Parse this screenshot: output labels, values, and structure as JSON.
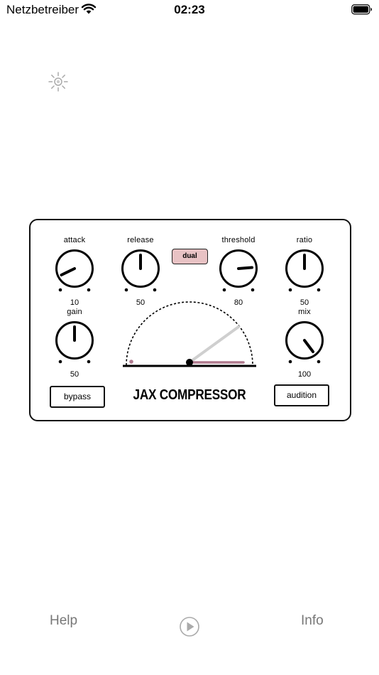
{
  "status_bar": {
    "carrier": "Netzbetreiber",
    "time": "02:23",
    "icons": [
      "wifi-icon",
      "battery-icon"
    ]
  },
  "toolbar": {
    "icon": "brightness-icon"
  },
  "plugin": {
    "title": "JAX COMPRESSOR",
    "knobs": {
      "attack": {
        "label": "attack",
        "value": "10"
      },
      "release": {
        "label": "release",
        "value": "50"
      },
      "threshold": {
        "label": "threshold",
        "value": "80"
      },
      "ratio": {
        "label": "ratio",
        "value": "50"
      },
      "gain": {
        "label": "gain",
        "value": "50"
      },
      "mix": {
        "label": "mix",
        "value": "100"
      }
    },
    "dual_label": "dual",
    "bypass_label": "bypass",
    "audition_label": "audition",
    "accent_color": "#e8c2c4",
    "meter_color": "#b07a8e"
  },
  "bottom": {
    "help_label": "Help",
    "info_label": "Info",
    "play_icon": "play-icon"
  }
}
